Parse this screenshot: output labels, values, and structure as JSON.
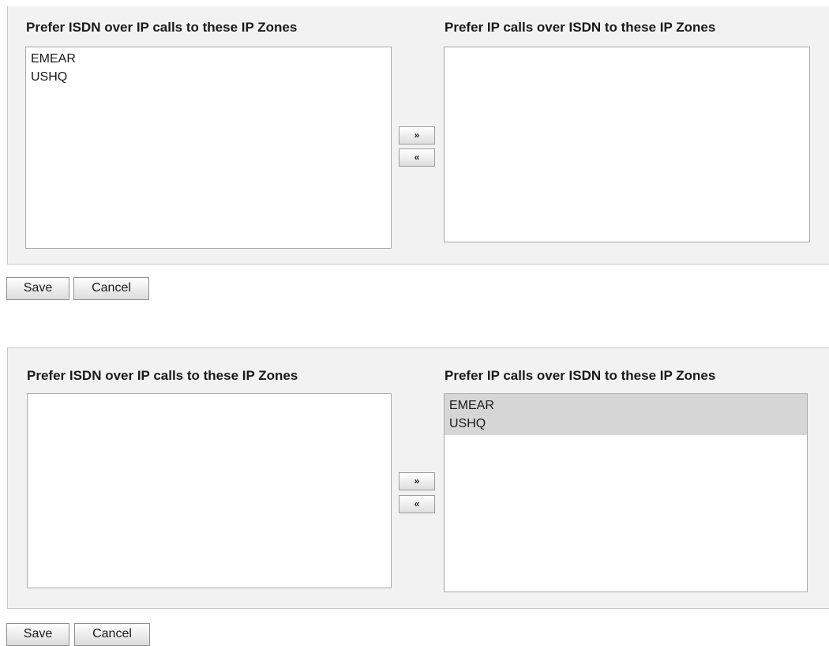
{
  "dialogs": [
    {
      "left_title": "Prefer ISDN over IP calls to these IP Zones",
      "right_title": "Prefer IP calls over ISDN to these IP Zones",
      "left_items": [
        {
          "label": "EMEAR",
          "selected": false
        },
        {
          "label": "USHQ",
          "selected": false
        }
      ],
      "right_items": [],
      "move_right_label": "»",
      "move_left_label": "«",
      "save_label": "Save",
      "cancel_label": "Cancel"
    },
    {
      "left_title": "Prefer ISDN over IP calls to these IP Zones",
      "right_title": "Prefer IP calls over ISDN to these IP Zones",
      "left_items": [],
      "right_items": [
        {
          "label": "EMEAR",
          "selected": true
        },
        {
          "label": "USHQ",
          "selected": true
        }
      ],
      "move_right_label": "»",
      "move_left_label": "«",
      "save_label": "Save",
      "cancel_label": "Cancel"
    }
  ]
}
